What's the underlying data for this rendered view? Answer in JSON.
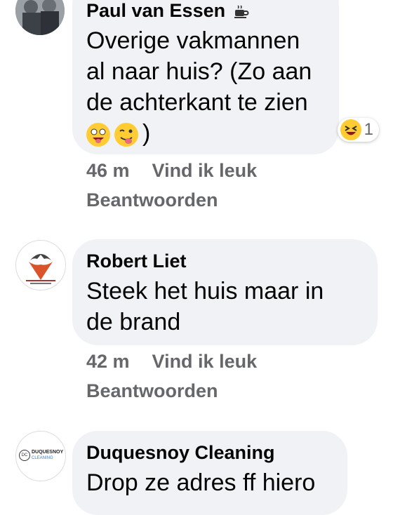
{
  "comments": [
    {
      "author": "Paul van Essen",
      "author_badge": "coffee-cup-icon",
      "text_lines": [
        "Overige vakmannen",
        "al naar huis? (Zo aan",
        "de achterkant te zien"
      ],
      "emoji_line_suffix": ")",
      "emojis": [
        "grinning-squinting-face-icon",
        "winking-tongue-face-icon"
      ],
      "reaction_count": "1",
      "reaction_icon": "laughing-face-icon",
      "time": "46 m",
      "like_label": "Vind ik leuk",
      "reply_label": "Beantwoorden"
    },
    {
      "author": "Robert Liet",
      "text_lines": [
        "Steek het huis maar in",
        "de brand"
      ],
      "time": "42 m",
      "like_label": "Vind ik leuk",
      "reply_label": "Beantwoorden"
    },
    {
      "author": "Duquesnoy Cleaning",
      "avatar_text": [
        "DUQUESNOY",
        "CLEANING"
      ],
      "avatar_badge": "DC",
      "text_lines": [
        "Drop ze adres ff hiero"
      ]
    }
  ],
  "colors": {
    "bubble": "#f0f2f5",
    "meta_text": "#65676b",
    "text": "#050505"
  }
}
